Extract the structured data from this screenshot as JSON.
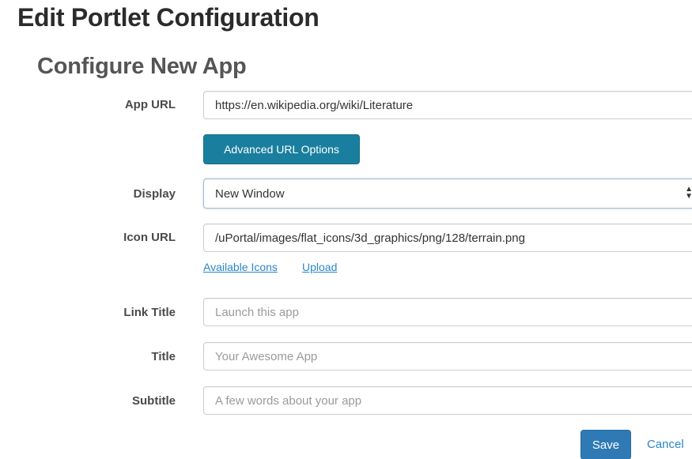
{
  "page_title": "Edit Portlet Configuration",
  "section_title": "Configure New App",
  "form": {
    "app_url": {
      "label": "App URL",
      "value": "https://en.wikipedia.org/wiki/Literature"
    },
    "advanced_button_label": "Advanced URL Options",
    "display": {
      "label": "Display",
      "selected": "New Window"
    },
    "icon_url": {
      "label": "Icon URL",
      "value": "/uPortal/images/flat_icons/3d_graphics/png/128/terrain.png"
    },
    "icon_links": {
      "available": "Available Icons",
      "upload": "Upload"
    },
    "link_title": {
      "label": "Link Title",
      "placeholder": "Launch this app"
    },
    "title": {
      "label": "Title",
      "placeholder": "Your Awesome App"
    },
    "subtitle": {
      "label": "Subtitle",
      "placeholder": "A few words about your app"
    }
  },
  "actions": {
    "save_label": "Save",
    "cancel_label": "Cancel"
  },
  "colors": {
    "advanced_button": "#1a7f9e",
    "save_button": "#2f7ab5",
    "link": "#2a87c8"
  }
}
